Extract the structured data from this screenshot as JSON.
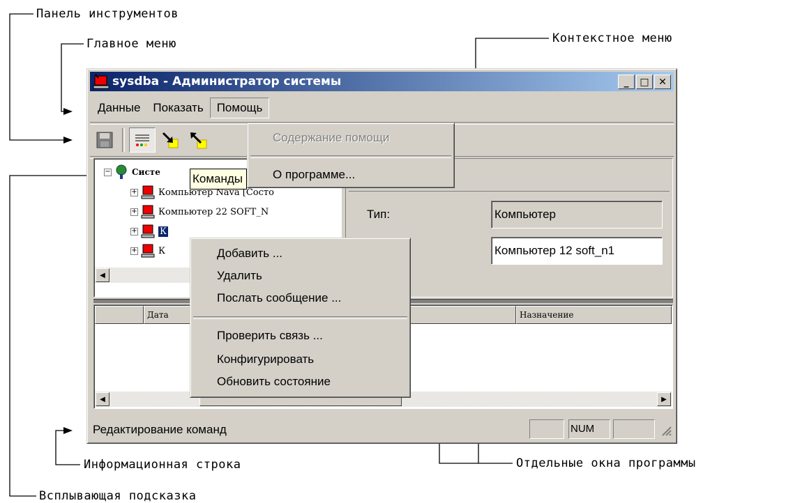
{
  "annotations": {
    "toolbar_panel": "Панель инструментов",
    "main_menu": "Главное меню",
    "context_menu": "Контекстное меню",
    "tooltip": "Всплывающая подсказка",
    "info_line": "Информационная строка",
    "separate_windows": "Отдельные окна программы"
  },
  "window": {
    "title": "sysdba - Администратор системы",
    "minimize": "_",
    "maximize": "□",
    "close": "✕"
  },
  "menu": {
    "items": [
      "Данные",
      "Показать",
      "Помощь"
    ]
  },
  "help_menu": {
    "items": [
      "Содержание помощи",
      "О программе..."
    ]
  },
  "tooltip": {
    "text": "Команды"
  },
  "tree": {
    "root": "Систе",
    "items": [
      "Компьютер Nava [Состо",
      "Компьютер 22 SOFT_N",
      "К",
      "К"
    ]
  },
  "details": {
    "type_label": "Тип:",
    "type_value": "Компьютер",
    "name_value": "Компьютер 12 soft_n1"
  },
  "context_menu": {
    "group1": [
      "Добавить ...",
      "Удалить",
      "Послать сообщение ..."
    ],
    "group2": [
      "Проверить связь ...",
      "Конфигурировать",
      "Обновить состояние"
    ]
  },
  "log_table": {
    "columns": [
      "Дата",
      "Назначение"
    ]
  },
  "status_bar": {
    "text": "Редактирование команд",
    "num": "NUM"
  }
}
